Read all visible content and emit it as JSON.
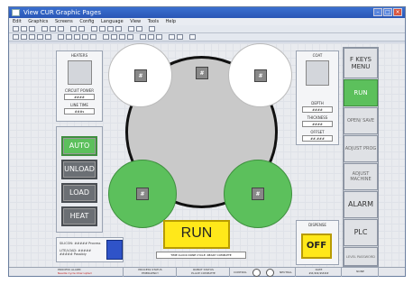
{
  "window": {
    "title": "View CUR Graphic Pages",
    "menu": [
      "Edit",
      "Graphics",
      "Screens",
      "Config",
      "Language",
      "View",
      "Tools",
      "Help"
    ]
  },
  "left_panel": {
    "heaters_label": "HEATERS",
    "readout1_label": "CIRCUIT POWER",
    "readout1_value": "####",
    "readout2_label": "LINE TIME",
    "readout2_value": "###s",
    "mode_buttons": [
      "AUTO",
      "UNLOAD",
      "LOAD",
      "HEAT"
    ],
    "status_line1": "SILICON: ##### Process",
    "status_line2": "LITE/LOAD: ##### ##### Possibly"
  },
  "center": {
    "station_marker": "#",
    "run_label": "RUN",
    "cycle_status": "TIME CLOCK DONE  CYCLE: READY COMPLETE"
  },
  "right_panel": {
    "coat_label": "COAT",
    "readout1_label": "DEPTH",
    "readout1_value": "####",
    "readout2_label": "THICKNESS",
    "readout2_value": "####",
    "readout3_label": "OFFSET",
    "readout3_value": "##.###",
    "dispense_label": "DISPENSE",
    "off_label": "OFF"
  },
  "fkeys": {
    "header": "F KEYS MENU",
    "buttons": [
      "RUN",
      "OPEN/ SAVE",
      "ADJUST PROG",
      "ADJUST MACHINE",
      "ALARM",
      "PLC",
      "LEVEL PASSWORD"
    ]
  },
  "bottom": {
    "process_alarm_label": "PROCESS ALARM",
    "process_alarm_value": "Needle Cycle Interrupted",
    "process_status_label": "PROCESS STATUS",
    "process_status_value": "EMERGENCY",
    "robot_status_label": "ROBOT STATUS",
    "robot_status_value": "PLACE COMPLETE",
    "control_label": "CONTROL",
    "neutral_label": "NEUTRAL",
    "date_label": "DATE",
    "date_value": "##/##/####",
    "extra": "NONE"
  },
  "colors": {
    "green": "#5cc05c",
    "yellow": "#ffe81a",
    "gray_button": "#6b6f74"
  }
}
